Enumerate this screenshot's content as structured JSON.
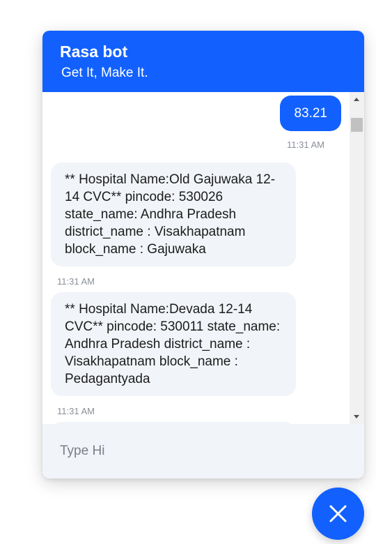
{
  "header": {
    "title": "Rasa bot",
    "subtitle": "Get It, Make It."
  },
  "messages": [
    {
      "sender": "user",
      "text": "83.21",
      "time": "11:31 AM"
    },
    {
      "sender": "bot",
      "text": "** Hospital Name:Old Gajuwaka 12-14 CVC** pincode: 530026 state_name: Andhra Pradesh district_name : Visakhapatnam block_name : Gajuwaka",
      "time": "11:31 AM"
    },
    {
      "sender": "bot",
      "text": "** Hospital Name:Devada 12-14 CVC** pincode: 530011 state_name: Andhra Pradesh district_name : Visakhapatnam block_name : Pedagantyada",
      "time": "11:31 AM"
    }
  ],
  "input": {
    "placeholder": "Type Hi",
    "value": ""
  },
  "launcher": {
    "icon": "close-icon"
  },
  "colors": {
    "primary": "#1261fe",
    "bot_bubble": "#f1f4f8",
    "timestamp": "#8a8f98"
  }
}
